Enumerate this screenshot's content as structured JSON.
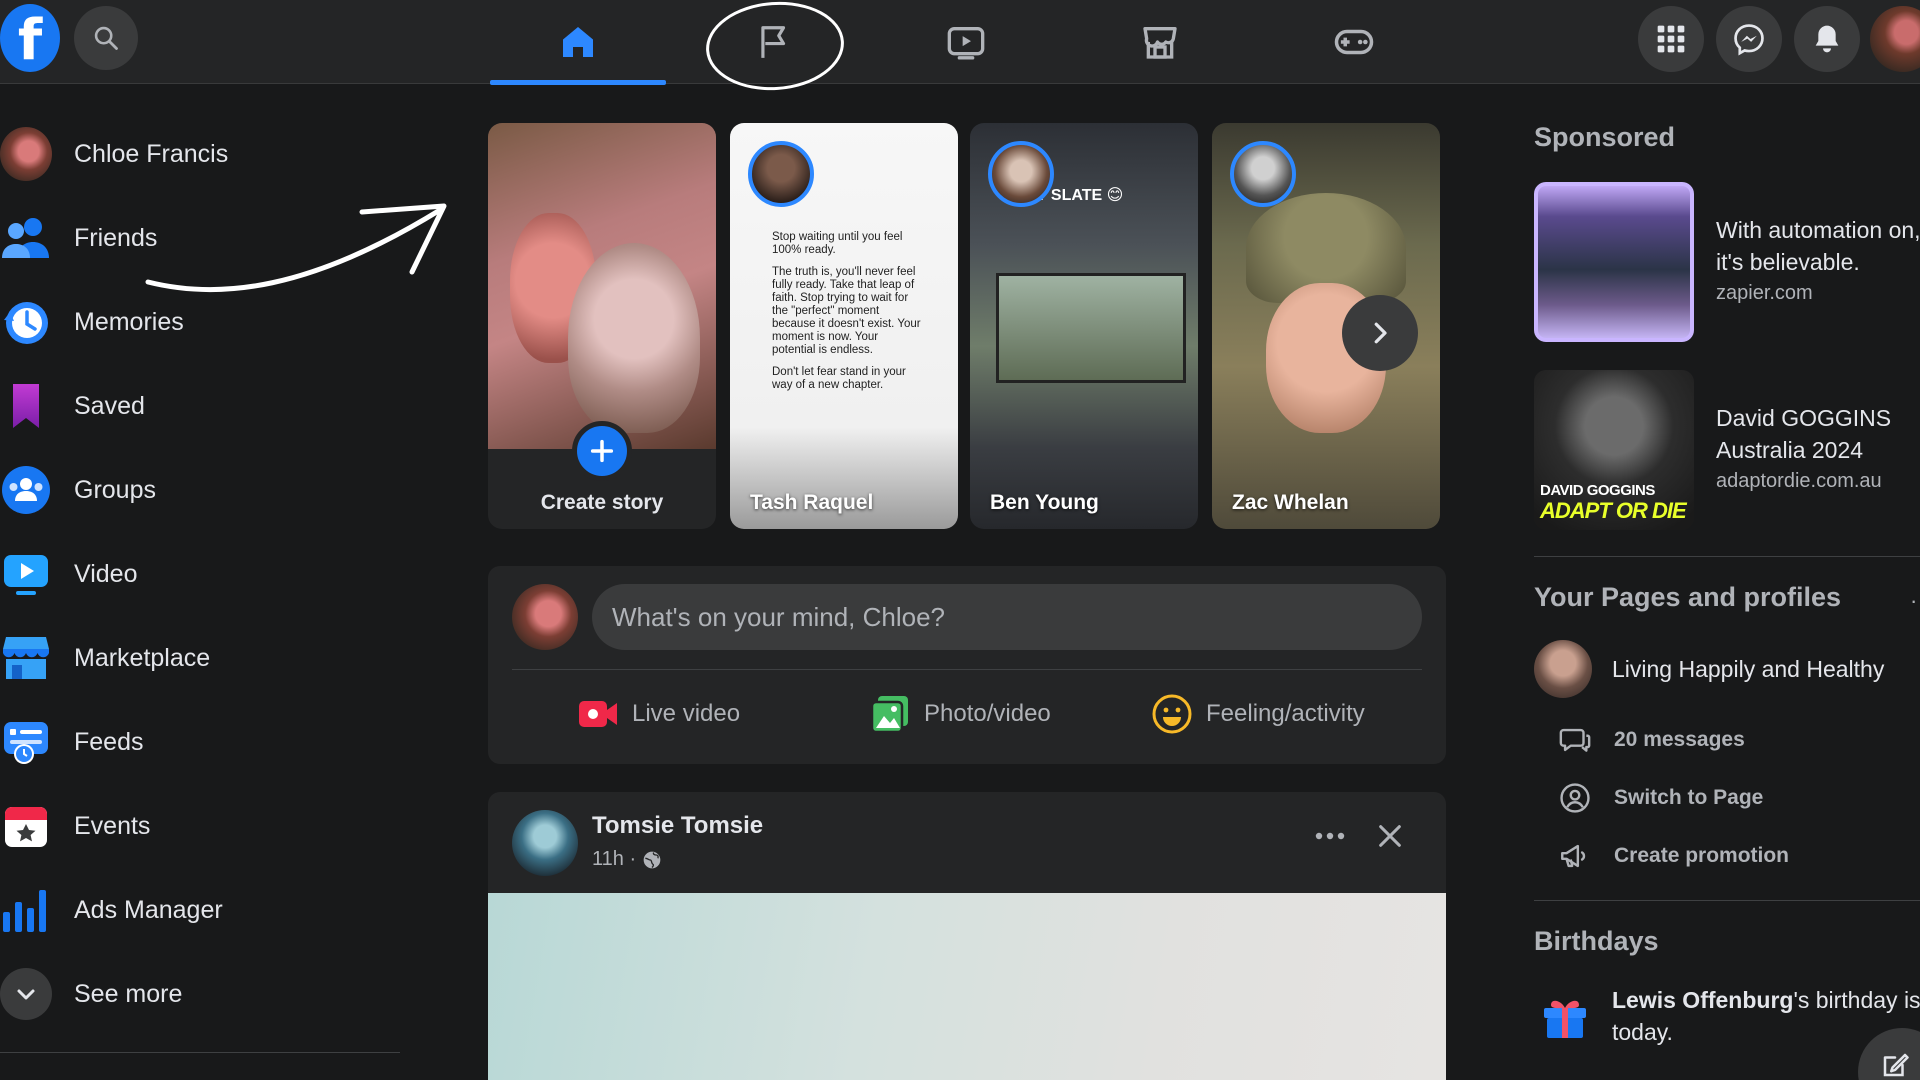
{
  "app": {
    "logo_letter": "f"
  },
  "topnav": {
    "tabs": [
      {
        "icon": "home-icon",
        "active": true
      },
      {
        "icon": "flag-pages-icon",
        "active": false
      },
      {
        "icon": "watch-video-icon",
        "active": false
      },
      {
        "icon": "marketplace-store-icon",
        "active": false
      },
      {
        "icon": "gaming-controller-icon",
        "active": false
      }
    ],
    "right_icons": [
      "apps-grid-icon",
      "messenger-icon",
      "notifications-bell-icon",
      "profile-avatar"
    ]
  },
  "sidebar": {
    "items": [
      {
        "label": "Chloe Francis",
        "icon": "profile-avatar"
      },
      {
        "label": "Friends",
        "icon": "friends-icon"
      },
      {
        "label": "Memories",
        "icon": "memories-clock-icon"
      },
      {
        "label": "Saved",
        "icon": "saved-bookmark-icon"
      },
      {
        "label": "Groups",
        "icon": "groups-icon"
      },
      {
        "label": "Video",
        "icon": "video-icon"
      },
      {
        "label": "Marketplace",
        "icon": "marketplace-icon"
      },
      {
        "label": "Feeds",
        "icon": "feeds-icon"
      },
      {
        "label": "Events",
        "icon": "events-calendar-icon"
      },
      {
        "label": "Ads Manager",
        "icon": "ads-manager-chart-icon"
      },
      {
        "label": "See more",
        "icon": "chevron-down-icon"
      }
    ]
  },
  "stories": {
    "create_label": "Create story",
    "items": [
      {
        "name": "Tash Raquel"
      },
      {
        "name": "Ben Young",
        "overlay_text": "ST SLATE 😊"
      },
      {
        "name": "Zac Whelan"
      }
    ],
    "tash_quote": [
      "Stop waiting until you feel 100% ready.",
      "The truth is, you'll never feel fully ready. Take that leap of faith. Stop trying to wait for the \"perfect\" moment because it doesn't exist. Your moment is now. Your potential is endless.",
      "Don't let fear stand in your way of a new chapter."
    ]
  },
  "composer": {
    "placeholder": "What's on your mind, Chloe?",
    "actions": [
      {
        "label": "Live video",
        "color": "#f02849"
      },
      {
        "label": "Photo/video",
        "color": "#45bd62"
      },
      {
        "label": "Feeling/activity",
        "color": "#f7b928"
      }
    ]
  },
  "post": {
    "author": "Tomsie Tomsie",
    "time": "11h ·"
  },
  "right": {
    "sponsored_heading": "Sponsored",
    "ads": [
      {
        "title": "With automation on, it's believable.",
        "url": "zapier.com"
      },
      {
        "title": "David GOGGINS Australia 2024",
        "url": "adaptordie.com.au",
        "image_text_1": "DAVID GOGGINS",
        "image_text_2": "ADAPT OR DIE"
      }
    ],
    "pages_heading": "Your Pages and profiles",
    "page_name": "Living Happily and Healthy",
    "page_actions": [
      {
        "label": "20 messages",
        "icon": "messages-icon"
      },
      {
        "label": "Switch to Page",
        "icon": "switch-profile-icon"
      },
      {
        "label": "Create promotion",
        "icon": "megaphone-icon"
      }
    ],
    "birthdays_heading": "Birthdays",
    "birthday_name": "Lewis Offenburg",
    "birthday_rest": "'s birthday is today."
  },
  "colors": {
    "accent": "#2d88ff",
    "brand": "#1877f2",
    "background": "#18191a",
    "surface": "#242526"
  }
}
